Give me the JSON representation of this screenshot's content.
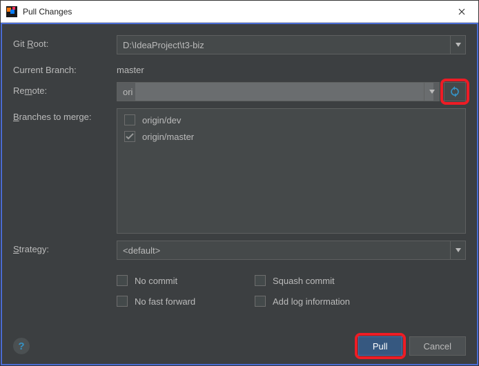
{
  "window": {
    "title": "Pull Changes"
  },
  "labels": {
    "git_root": "Git Root:",
    "git_root_u": "R",
    "current_branch": "Current Branch:",
    "remote": "Remote:",
    "remote_u": "m",
    "branches": "Branches to merge:",
    "branches_u": "B",
    "strategy": "Strategy:",
    "strategy_u": "S"
  },
  "values": {
    "git_root": "D:\\IdeaProject\\t3-biz",
    "current_branch": "master",
    "remote": "ori",
    "strategy": "<default>"
  },
  "branches": [
    {
      "label": "origin/dev",
      "checked": false
    },
    {
      "label": "origin/master",
      "checked": true
    }
  ],
  "options": {
    "no_commit": "No commit",
    "squash": "Squash commit",
    "no_ff": "No fast forward",
    "add_log": "Add log information"
  },
  "buttons": {
    "pull": "Pull",
    "cancel": "Cancel",
    "help": "?"
  }
}
